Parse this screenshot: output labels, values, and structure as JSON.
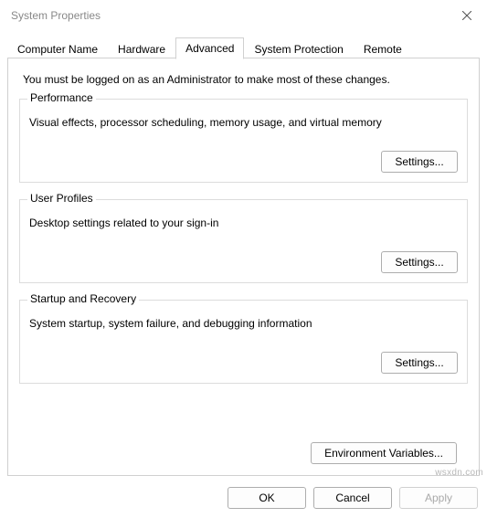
{
  "window": {
    "title": "System Properties"
  },
  "tabs": [
    {
      "label": "Computer Name"
    },
    {
      "label": "Hardware"
    },
    {
      "label": "Advanced"
    },
    {
      "label": "System Protection"
    },
    {
      "label": "Remote"
    }
  ],
  "intro": "You must be logged on as an Administrator to make most of these changes.",
  "groups": {
    "performance": {
      "legend": "Performance",
      "desc": "Visual effects, processor scheduling, memory usage, and virtual memory",
      "settings_label": "Settings..."
    },
    "user_profiles": {
      "legend": "User Profiles",
      "desc": "Desktop settings related to your sign-in",
      "settings_label": "Settings..."
    },
    "startup": {
      "legend": "Startup and Recovery",
      "desc": "System startup, system failure, and debugging information",
      "settings_label": "Settings..."
    }
  },
  "env_button": "Environment Variables...",
  "buttons": {
    "ok": "OK",
    "cancel": "Cancel",
    "apply": "Apply"
  },
  "watermark": "wsxdn.com"
}
